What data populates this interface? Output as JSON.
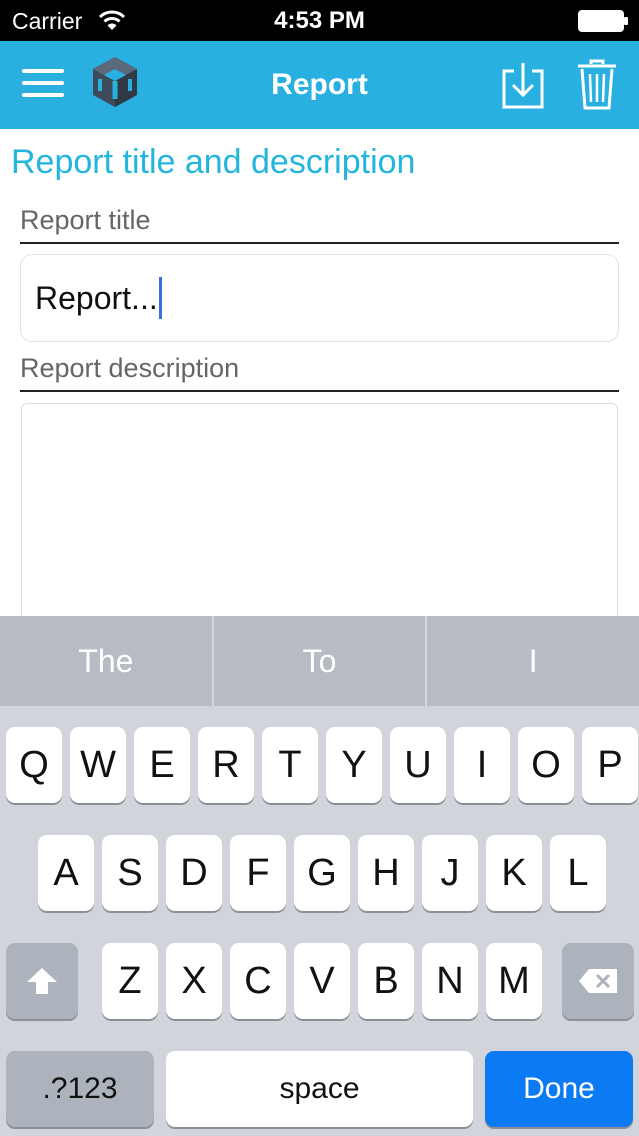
{
  "status_bar": {
    "carrier": "Carrier",
    "time": "4:53 PM"
  },
  "nav": {
    "title": "Report"
  },
  "form": {
    "section_heading": "Report title and description",
    "title_label": "Report title",
    "title_value": "Report...",
    "description_label": "Report description",
    "description_value": ""
  },
  "keyboard": {
    "suggestions": [
      "The",
      "To",
      "I"
    ],
    "row1": [
      "Q",
      "W",
      "E",
      "R",
      "T",
      "Y",
      "U",
      "I",
      "O",
      "P"
    ],
    "row2": [
      "A",
      "S",
      "D",
      "F",
      "G",
      "H",
      "J",
      "K",
      "L"
    ],
    "row3": [
      "Z",
      "X",
      "C",
      "V",
      "B",
      "N",
      "M"
    ],
    "numbers_label": ".?123",
    "space_label": "space",
    "done_label": "Done"
  },
  "colors": {
    "nav_background": "#29b0e0",
    "heading": "#24b5dc",
    "done_key": "#0c7bf3",
    "caret": "#3a6fdd"
  },
  "icons": {
    "menu": "hamburger-icon",
    "logo": "cube-logo-icon",
    "download": "download-icon",
    "delete": "trash-icon",
    "shift": "shift-arrow-icon",
    "backspace": "backspace-icon"
  }
}
